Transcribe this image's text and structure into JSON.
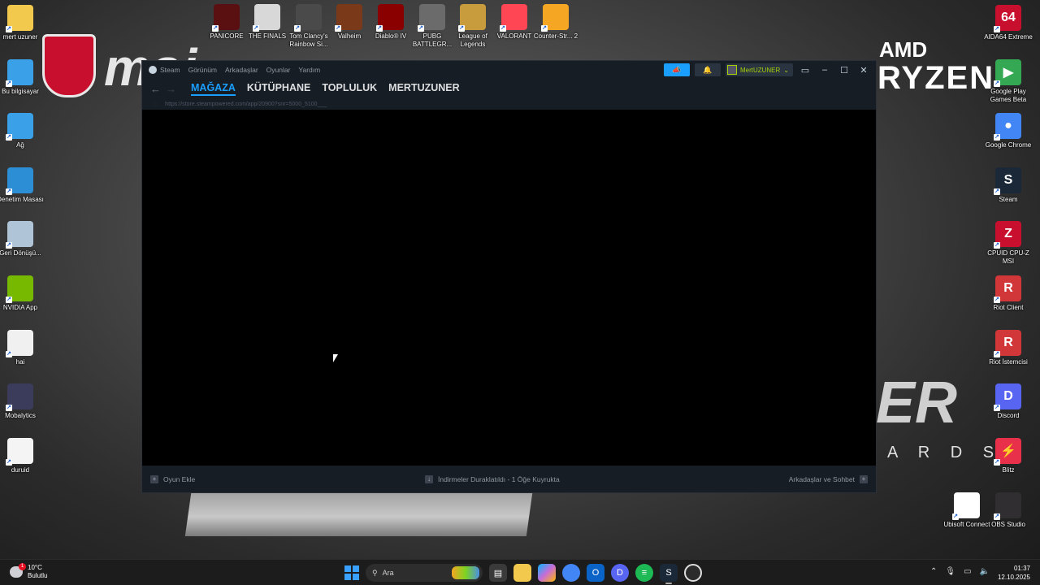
{
  "wallpaper": {
    "msi_text": "msi",
    "amd_text": "AMD",
    "ryzen_text": "RYZEN",
    "er_text": "ER",
    "ards_text": "A R D S"
  },
  "desktop_left": [
    {
      "label": "mert uzuner",
      "icon": "folder-icon",
      "color": "#f2c94c"
    },
    {
      "label": "Bu bilgisayar",
      "icon": "computer-icon",
      "color": "#3aa0e8"
    },
    {
      "label": "Ağ",
      "icon": "network-icon",
      "color": "#3aa0e8"
    },
    {
      "label": "Denetim Masası",
      "icon": "control-panel-icon",
      "color": "#2c8fd6"
    },
    {
      "label": "Geri Dönüşü...",
      "icon": "recycle-bin-icon",
      "color": "#b0c4d8"
    },
    {
      "label": "NVIDIA App",
      "icon": "nvidia-icon",
      "color": "#76b900"
    },
    {
      "label": "hai",
      "icon": "document-icon",
      "color": "#f0f0f0"
    },
    {
      "label": "Mobalytics",
      "icon": "mobalytics-icon",
      "color": "#3b3b5c"
    },
    {
      "label": "duruid",
      "icon": "file-icon",
      "color": "#f4f4f4"
    }
  ],
  "desktop_top": [
    {
      "label": "PANICORE",
      "icon": "panicore-icon",
      "color": "#5a1010"
    },
    {
      "label": "THE FINALS",
      "icon": "the-finals-icon",
      "color": "#d8d8d8"
    },
    {
      "label": "Tom Clancy's Rainbow Si...",
      "icon": "rainbow-six-icon",
      "color": "#4a4a4a"
    },
    {
      "label": "Valheim",
      "icon": "valheim-icon",
      "color": "#7a3a1a"
    },
    {
      "label": "Diablo® IV",
      "icon": "diablo-icon",
      "color": "#8a0000"
    },
    {
      "label": "PUBG BATTLEGR...",
      "icon": "pubg-icon",
      "color": "#6b6b6b"
    },
    {
      "label": "League of Legends",
      "icon": "league-icon",
      "color": "#c89b3c"
    },
    {
      "label": "VALORANT",
      "icon": "valorant-icon",
      "color": "#ff4655"
    },
    {
      "label": "Counter-Str... 2",
      "icon": "cs2-icon",
      "color": "#f5a623"
    }
  ],
  "desktop_right": [
    {
      "label": "AIDA64 Extreme",
      "icon": "aida64-icon",
      "color": "#c8102e",
      "glyph": "64"
    },
    {
      "label": "Google Play Games Beta",
      "icon": "google-play-games-icon",
      "color": "#34a853",
      "glyph": "▶"
    },
    {
      "label": "Google Chrome",
      "icon": "chrome-icon",
      "color": "#4285f4",
      "glyph": "●"
    },
    {
      "label": "Steam",
      "icon": "steam-icon",
      "color": "#1b2838",
      "glyph": "S"
    },
    {
      "label": "CPUID CPU-Z MSI",
      "icon": "cpuz-icon",
      "color": "#c8102e",
      "glyph": "Z"
    },
    {
      "label": "Riot Client",
      "icon": "riot-client-icon",
      "color": "#d13639",
      "glyph": "R"
    },
    {
      "label": "Riot İstemcisi",
      "icon": "riot-istemcisi-icon",
      "color": "#d13639",
      "glyph": "R"
    },
    {
      "label": "Discord",
      "icon": "discord-icon",
      "color": "#5865f2",
      "glyph": "D"
    },
    {
      "label": "Blitz",
      "icon": "blitz-icon",
      "color": "#e8304a",
      "glyph": "⚡"
    }
  ],
  "desktop_bottom_right": [
    {
      "label": "Ubisoft Connect",
      "icon": "ubisoft-icon",
      "color": "#ffffff"
    },
    {
      "label": "OBS Studio",
      "icon": "obs-icon",
      "color": "#302e31"
    }
  ],
  "steam": {
    "menu": [
      "Steam",
      "Görünüm",
      "Arkadaşlar",
      "Oyunlar",
      "Yardım"
    ],
    "username": "MertUZUNER",
    "tabs": [
      "MAĞAZA",
      "KÜTÜPHANE",
      "TOPLULUK",
      "MERTUZUNER"
    ],
    "url": "https://store.steampowered.com/app/20900?snr=5000_5100___",
    "footer": {
      "add_game": "Oyun Ekle",
      "downloads": "İndirmeler Duraklatıldı - 1 Öğe Kuyrukta",
      "friends": "Arkadaşlar ve Sohbet"
    }
  },
  "taskbar": {
    "temperature": "10°C",
    "condition": "Bulutlu",
    "weather_badge": "1",
    "search_placeholder": "Ara",
    "time": "01:37",
    "date": "12.10.2025"
  }
}
